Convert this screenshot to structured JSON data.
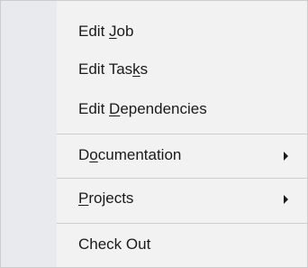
{
  "menu": {
    "items": [
      {
        "pre": "Edit ",
        "key": "J",
        "post": "ob",
        "has_submenu": false
      },
      {
        "pre": "Edit Tas",
        "key": "k",
        "post": "s",
        "has_submenu": false
      },
      {
        "pre": "Edit ",
        "key": "D",
        "post": "ependencies",
        "has_submenu": false
      },
      {
        "pre": "D",
        "key": "o",
        "post": "cumentation",
        "has_submenu": true
      },
      {
        "pre": "",
        "key": "P",
        "post": "rojects",
        "has_submenu": true
      },
      {
        "pre": "Check Out",
        "key": "",
        "post": "",
        "has_submenu": false
      }
    ]
  },
  "icons": {
    "submenu_arrow": "chevron-right-icon"
  },
  "colors": {
    "menu_background": "#f2f2f2",
    "gutter_background": "#e8eaed",
    "separator": "#cfcfcf",
    "text": "#1a1a1a"
  }
}
